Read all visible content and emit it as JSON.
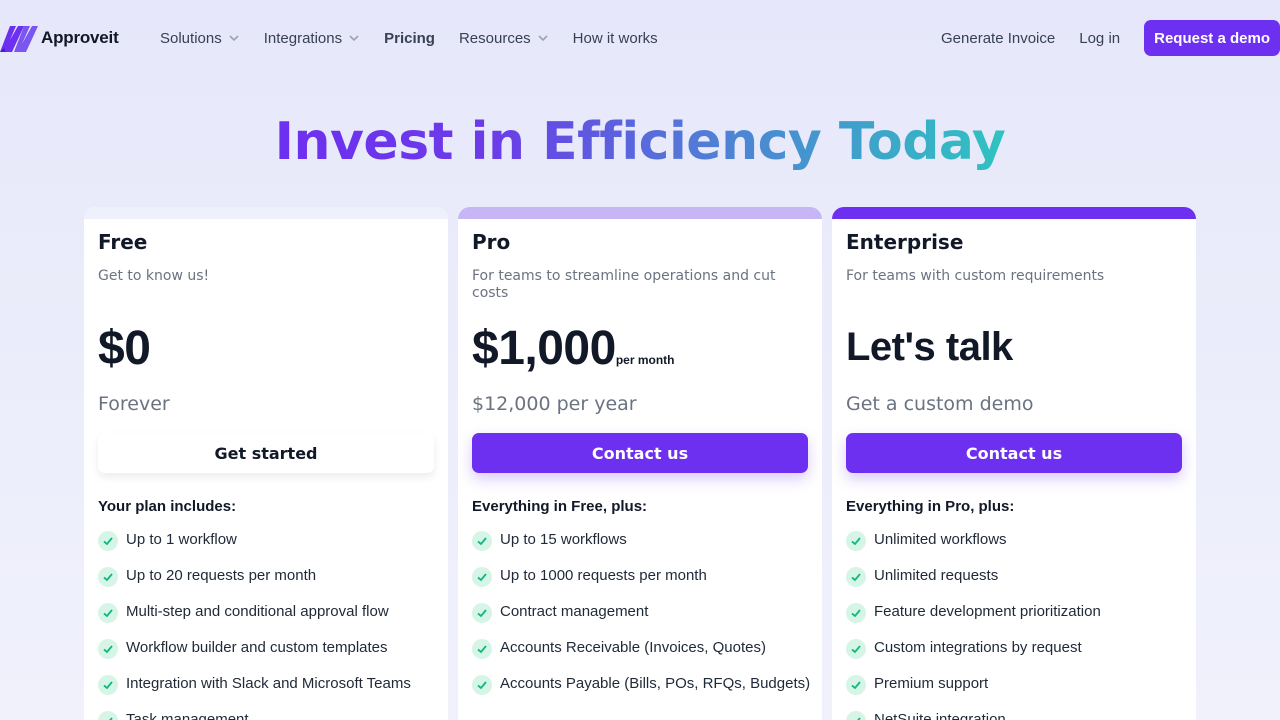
{
  "brand": {
    "name": "Approveit"
  },
  "nav": {
    "links": [
      {
        "label": "Solutions",
        "dropdown": true
      },
      {
        "label": "Integrations",
        "dropdown": true
      },
      {
        "label": "Pricing",
        "dropdown": false
      },
      {
        "label": "Resources",
        "dropdown": true
      },
      {
        "label": "How it works",
        "dropdown": false
      }
    ],
    "generate_invoice": "Generate Invoice",
    "login": "Log in",
    "request_demo": "Request a demo"
  },
  "hero": {
    "title": "Invest in Efficiency Today"
  },
  "colors": {
    "accent": "#6d2ff0",
    "accent_light": "#c6b6f6",
    "check_bg": "#d6f5e6",
    "check": "#10b981"
  },
  "plans": [
    {
      "name": "Free",
      "description": "Get to know us!",
      "price": "$0",
      "price_suffix": "",
      "period": "Forever",
      "cta": "Get started",
      "includes_title": "Your plan includes:",
      "features": [
        "Up to 1 workflow",
        "Up to 20 requests per month",
        "Multi-step and conditional approval flow",
        "Workflow builder and custom templates",
        "Integration with Slack and Microsoft Teams",
        "Task management"
      ]
    },
    {
      "name": "Pro",
      "description": "For teams to streamline operations and cut costs",
      "price": "$1,000",
      "price_suffix": "per month",
      "period": "$12,000 per year",
      "cta": "Contact us",
      "includes_title": "Everything in Free, plus:",
      "features": [
        "Up to 15 workflows",
        "Up to 1000 requests per month",
        "Contract management",
        "Accounts Receivable (Invoices, Quotes)",
        "Accounts Payable (Bills, POs, RFQs, Budgets)"
      ]
    },
    {
      "name": "Enterprise",
      "description": "For teams with custom requirements",
      "price": "Let's talk",
      "price_suffix": "",
      "period": "Get a custom demo",
      "cta": "Contact us",
      "includes_title": "Everything in Pro, plus:",
      "features": [
        "Unlimited workflows",
        "Unlimited requests",
        "Feature development prioritization",
        "Custom integrations by request",
        "Premium support",
        "NetSuite integration"
      ]
    }
  ]
}
